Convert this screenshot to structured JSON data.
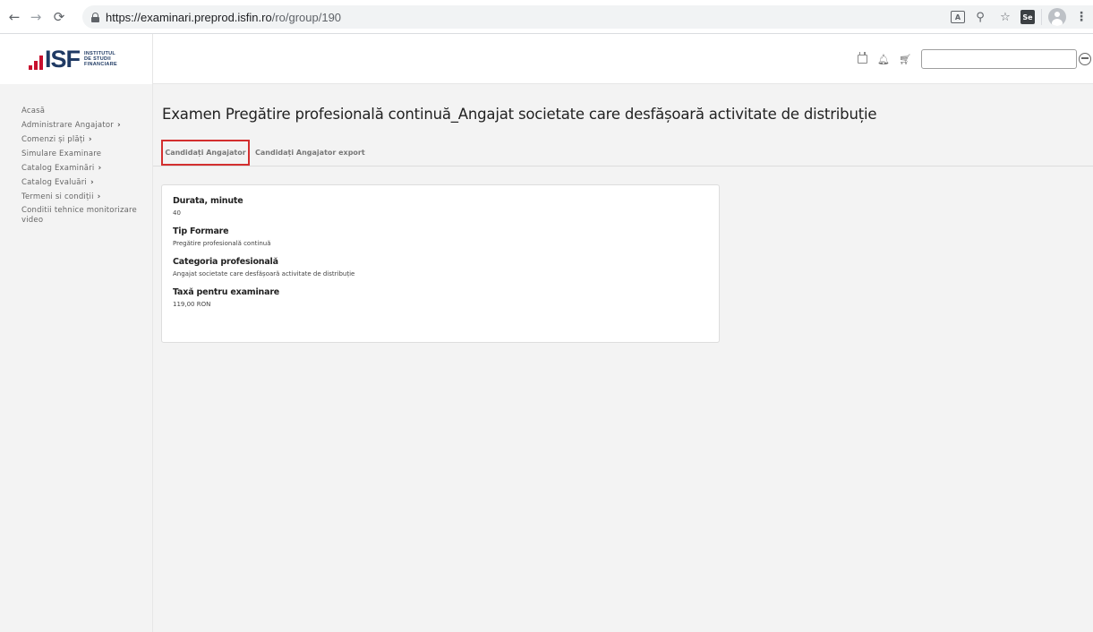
{
  "browser": {
    "url_host": "https://examinari.preprod.isfin.ro",
    "url_path": "/ro/group/190",
    "icons": [
      "back-icon",
      "forward-icon",
      "reload-icon",
      "lock-icon",
      "translate-icon",
      "zoom-icon",
      "star-icon",
      "extension-icon",
      "avatar-icon",
      "menu-icon"
    ]
  },
  "logo": {
    "letters": "ISF",
    "line1": "INSTITUTUL",
    "line2": "DE STUDII",
    "line3": "FINANCIARE",
    "colors": {
      "red": "#c8102e",
      "blue": "#1f3a64"
    }
  },
  "header": {
    "icons": [
      "calendar-icon",
      "bell-icon",
      "cart-icon",
      "user-icon"
    ],
    "search_value": ""
  },
  "sidebar": {
    "items": [
      {
        "label": "Acasă",
        "has_chevron": false
      },
      {
        "label": "Administrare Angajator",
        "has_chevron": true
      },
      {
        "label": "Comenzi și plăți",
        "has_chevron": true
      },
      {
        "label": "Simulare Examinare",
        "has_chevron": false
      },
      {
        "label": "Catalog Examinări",
        "has_chevron": true
      },
      {
        "label": "Catalog Evaluări",
        "has_chevron": true
      },
      {
        "label": "Termeni si condiții",
        "has_chevron": true
      },
      {
        "label": "Conditii tehnice monitorizare video",
        "has_chevron": false
      }
    ],
    "chevron": "›"
  },
  "main": {
    "title": "Examen Pregătire profesională continuă_Angajat societate care desfășoară activitate de distribuție",
    "tabs": [
      {
        "label": "Candidați Angajator",
        "active": true
      },
      {
        "label": "Candidați Angajator export",
        "active": false
      }
    ],
    "fields": [
      {
        "label": "Durata, minute",
        "value": "40"
      },
      {
        "label": "Tip Formare",
        "value": "Pregătire profesională continuă"
      },
      {
        "label": "Categoria profesională",
        "value": "Angajat societate care desfășoară activitate de distribuție"
      },
      {
        "label": "Taxă pentru examinare",
        "value": "119,00 RON"
      }
    ]
  },
  "colors": {
    "highlight_border": "#d32f2f",
    "background": "#f3f3f3"
  }
}
